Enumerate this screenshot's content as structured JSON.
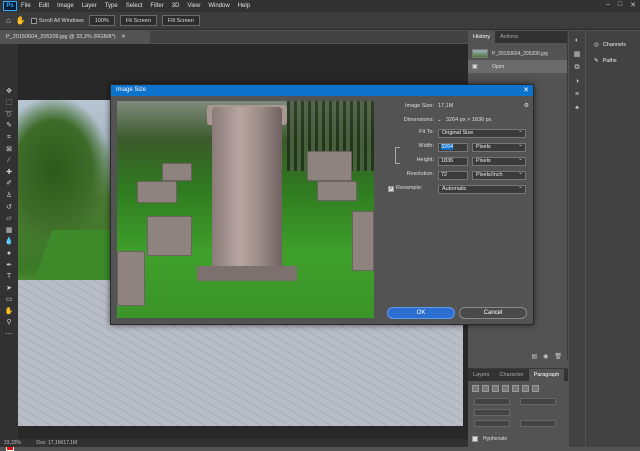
{
  "menubar": {
    "logo": "Ps",
    "items": [
      "File",
      "Edit",
      "Image",
      "Layer",
      "Type",
      "Select",
      "Filter",
      "3D",
      "View",
      "Window",
      "Help"
    ]
  },
  "options": {
    "scroll_all_windows": "Scroll All Windows",
    "zoom_100": "100%",
    "fit_screen": "Fit Screen",
    "fill_screen": "Fill Screen"
  },
  "document": {
    "tab_title": "P_20150604_205209.jpg @ 33,3% (RGB/8*)",
    "status_zoom": "33,33%",
    "status_doc": "Doc: 17,1M/17,1M"
  },
  "history_panel": {
    "tabs": [
      "History",
      "Actions"
    ],
    "snapshot_name": "P_20150604_205209.jpg",
    "state": "Open"
  },
  "channels_panel": {
    "items": [
      "Channels",
      "Paths"
    ]
  },
  "paragraph_panel": {
    "tabs": [
      "Layers",
      "Character",
      "Paragraph"
    ],
    "hyphenate_label": "Hyphenate",
    "hyphenate_checked": true
  },
  "colors": {
    "foreground": "#e01010",
    "background": "#e01010",
    "accent": "#0d72cc"
  },
  "dialog": {
    "title": "Image Size",
    "image_size_label": "Image Size:",
    "image_size_value": "17,1M",
    "dimensions_label": "Dimensions:",
    "dimensions_value": "3264 px  ×  1836 px",
    "fit_to_label": "Fit To:",
    "fit_to_value": "Original Size",
    "width_label": "Width:",
    "width_value": "3264",
    "width_unit": "Pixels",
    "height_label": "Height:",
    "height_value": "1836",
    "height_unit": "Pixels",
    "resolution_label": "Resolution:",
    "resolution_value": "72",
    "resolution_unit": "Pixels/Inch",
    "resample_label": "Resample:",
    "resample_checked": true,
    "resample_value": "Automatic",
    "ok_label": "OK",
    "cancel_label": "Cancel"
  }
}
